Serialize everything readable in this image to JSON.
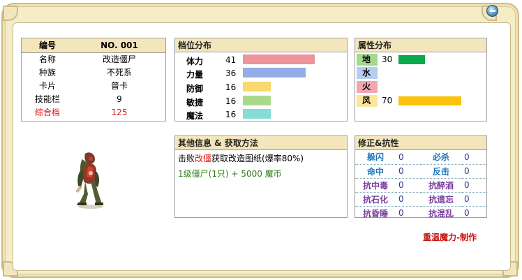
{
  "basic": {
    "header": {
      "key": "编号",
      "value": "NO. 001"
    },
    "rows": [
      {
        "key": "名称",
        "value": "改造僵尸"
      },
      {
        "key": "种族",
        "value": "不死系"
      },
      {
        "key": "卡片",
        "value": "普卡"
      },
      {
        "key": "技能栏",
        "value": "9"
      },
      {
        "key": "综合档",
        "value": "125"
      }
    ]
  },
  "stats": {
    "title": "档位分布",
    "items": [
      {
        "label": "体力",
        "value": 41,
        "color": "#ee949b"
      },
      {
        "label": "力量",
        "value": 36,
        "color": "#93aee6"
      },
      {
        "label": "防御",
        "value": 16,
        "color": "#fad86d"
      },
      {
        "label": "敏捷",
        "value": 16,
        "color": "#abd98b"
      },
      {
        "label": "魔法",
        "value": 16,
        "color": "#86dcd6"
      }
    ]
  },
  "attributes": {
    "title": "属性分布",
    "items": [
      {
        "label": "地",
        "value": "30",
        "chip": "#a3d98c",
        "bar": "#0aa94b",
        "level": 30
      },
      {
        "label": "水",
        "value": "",
        "chip": "#b6cdf0",
        "bar": "",
        "level": 0
      },
      {
        "label": "火",
        "value": "",
        "chip": "#f2a7ae",
        "bar": "",
        "level": 0
      },
      {
        "label": "风",
        "value": "70",
        "chip": "#fbe69a",
        "bar": "#fcc20e",
        "level": 70
      }
    ]
  },
  "other": {
    "title": "其他信息 & 获取方法",
    "line1_prefix": "击败",
    "line1_highlight": "改僵",
    "line1_suffix": "获取改造图纸(爆率80%)",
    "line2": "1级僵尸(1只) + 5000 魔币"
  },
  "modifiers": {
    "title": "修正&抗性",
    "rows": [
      {
        "a": "躲闪",
        "av": "0",
        "b": "必杀",
        "bv": "0",
        "tone": "blue"
      },
      {
        "a": "命中",
        "av": "0",
        "b": "反击",
        "bv": "0",
        "tone": "blue"
      },
      {
        "a": "抗中毒",
        "av": "0",
        "b": "抗醉酒",
        "bv": "0",
        "tone": "purple"
      },
      {
        "a": "抗石化",
        "av": "0",
        "b": "抗遗忘",
        "bv": "0",
        "tone": "purple"
      },
      {
        "a": "抗昏睡",
        "av": "0",
        "b": "抗混乱",
        "bv": "0",
        "tone": "purple"
      }
    ]
  },
  "credit": "重温魔力-制作"
}
